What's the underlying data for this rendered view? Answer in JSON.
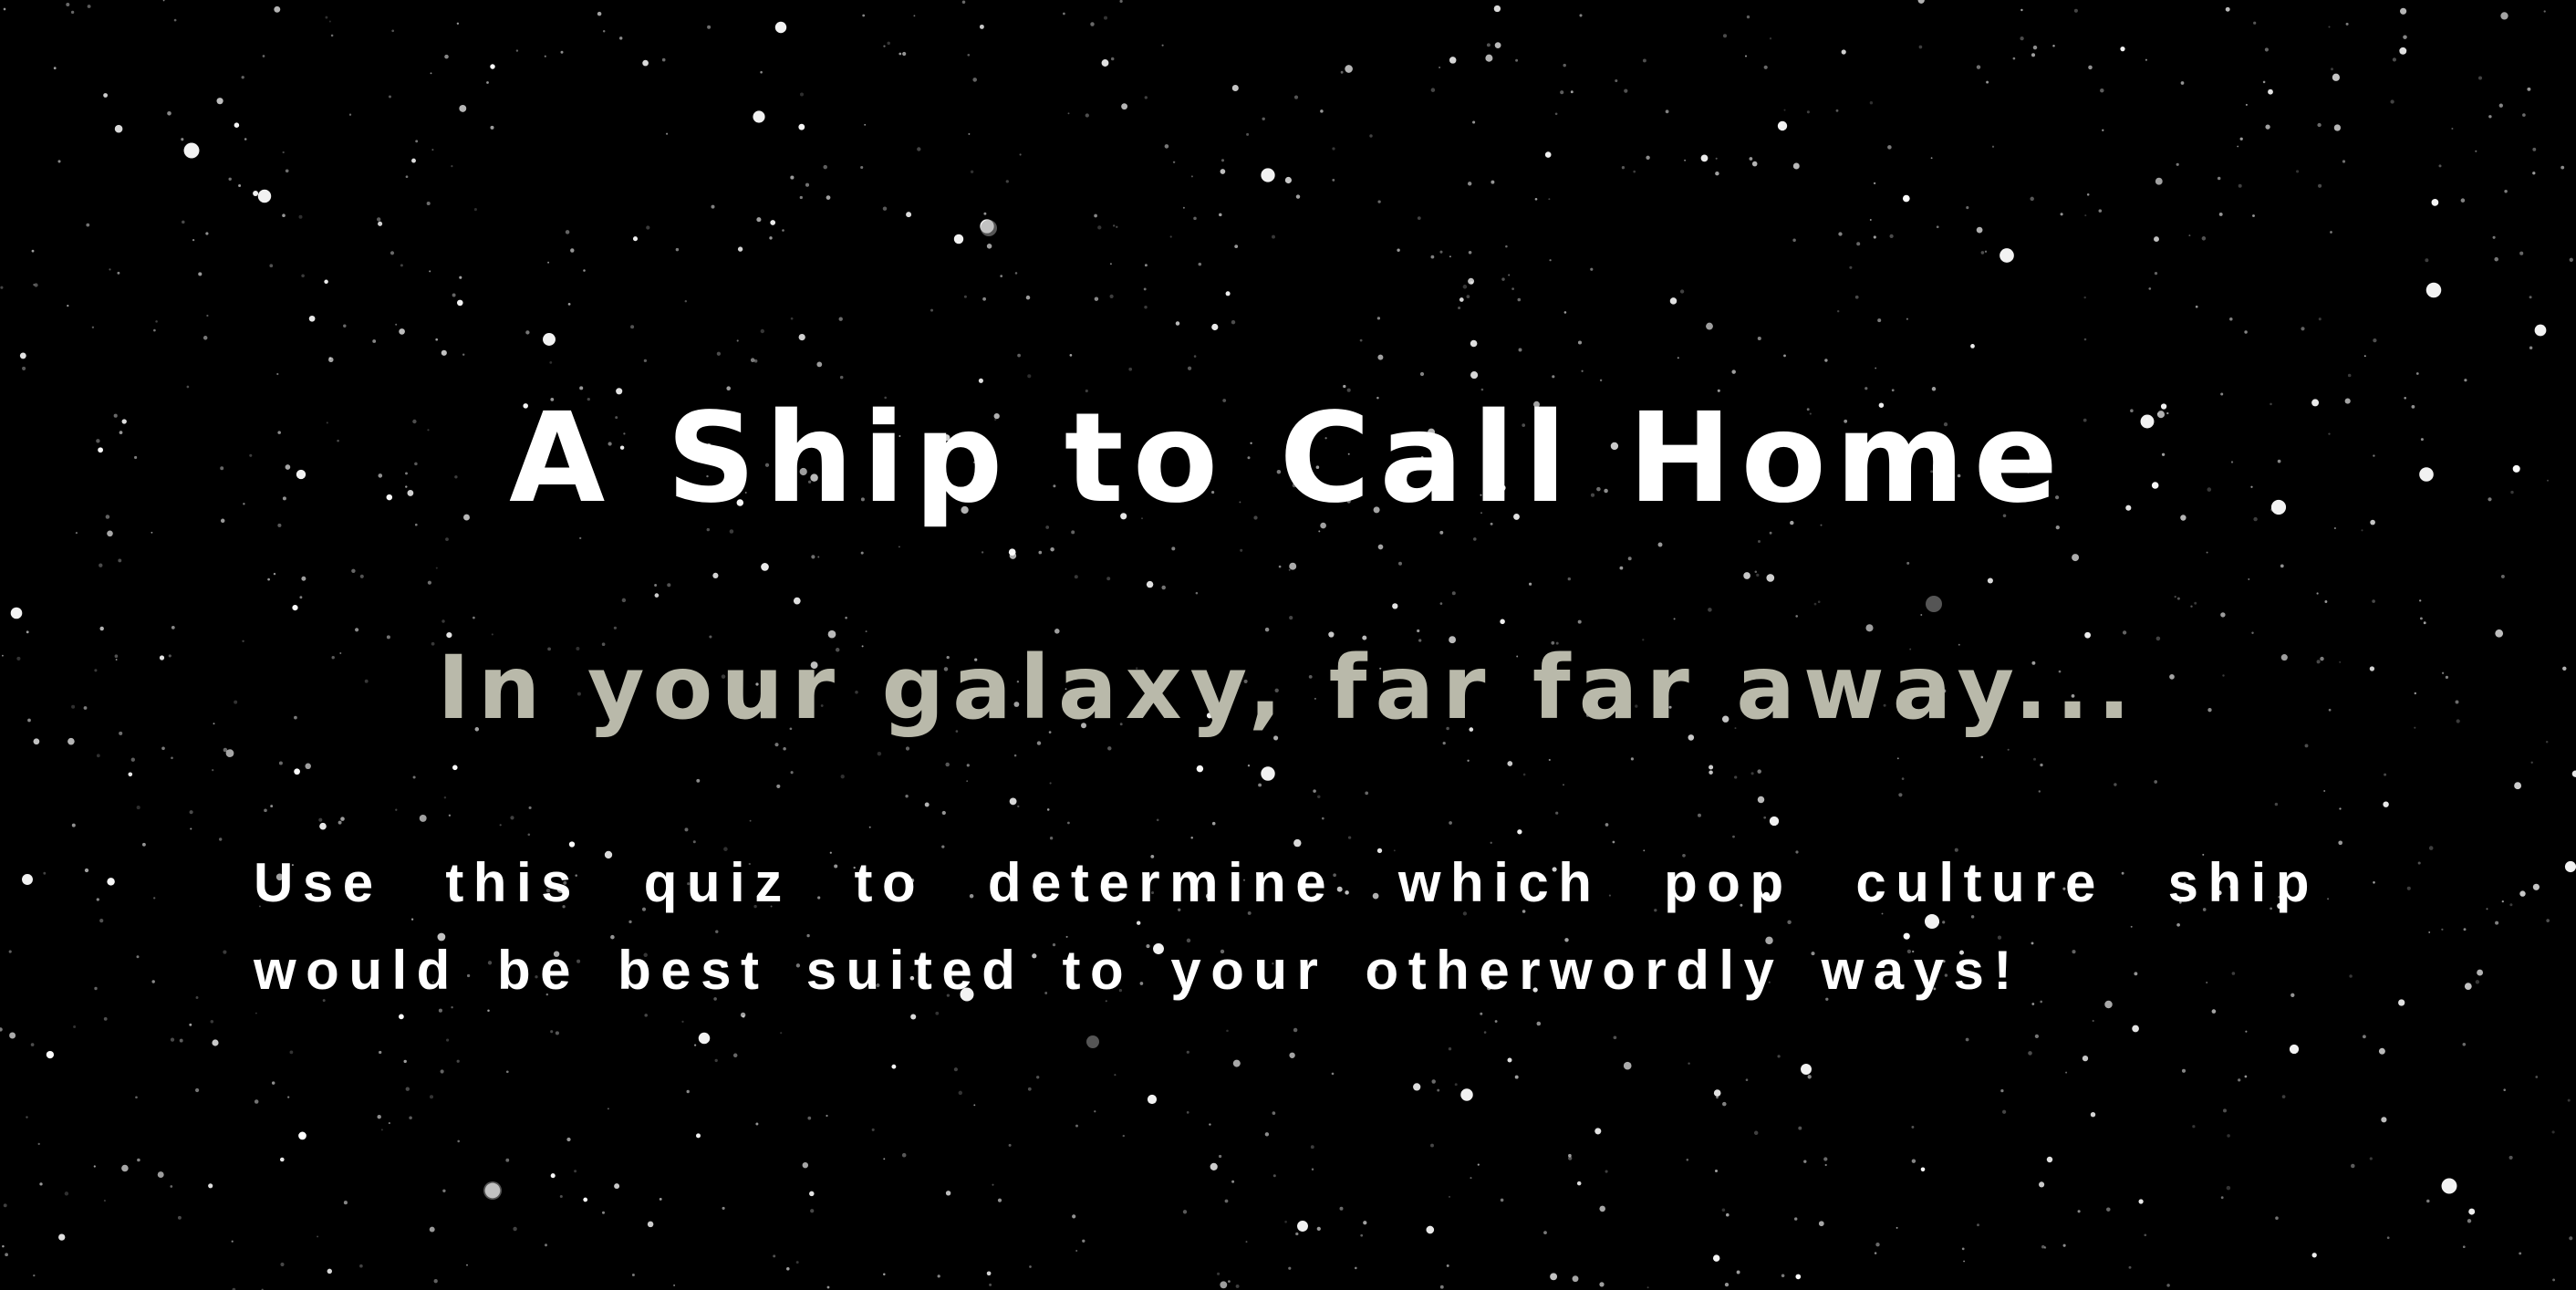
{
  "hero": {
    "title": "A Ship to Call Home",
    "subtitle": "In your galaxy, far far away...",
    "description": "Use this quiz to determine which pop culture ship would be best suited to your otherwordly ways!"
  },
  "colors": {
    "background": "#000000",
    "title": "#ffffff",
    "subtitle": "#b9b9aa",
    "description": "#ffffff",
    "stars": "#ffffff"
  }
}
